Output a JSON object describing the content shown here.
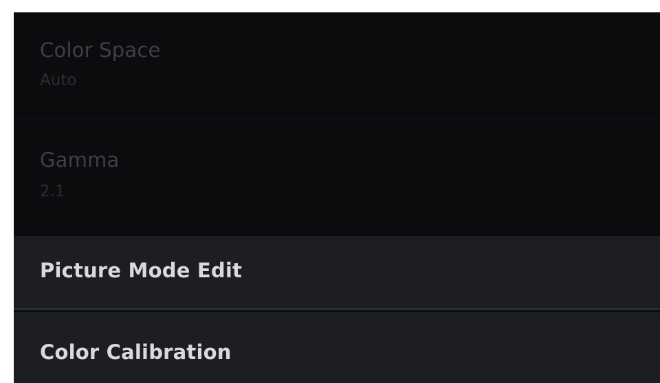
{
  "menu": {
    "items": [
      {
        "title": "Color Space",
        "value": "Auto",
        "enabled": false
      },
      {
        "title": "Gamma",
        "value": "2.1",
        "enabled": false
      },
      {
        "title": "Picture Mode Edit",
        "enabled": true
      },
      {
        "title": "Color Calibration",
        "enabled": true
      }
    ]
  },
  "colors": {
    "background": "#0a0b0d",
    "enabled_row": "#1c1e21",
    "enabled_text": "#d9dadc",
    "disabled_text": "#3e4044"
  }
}
